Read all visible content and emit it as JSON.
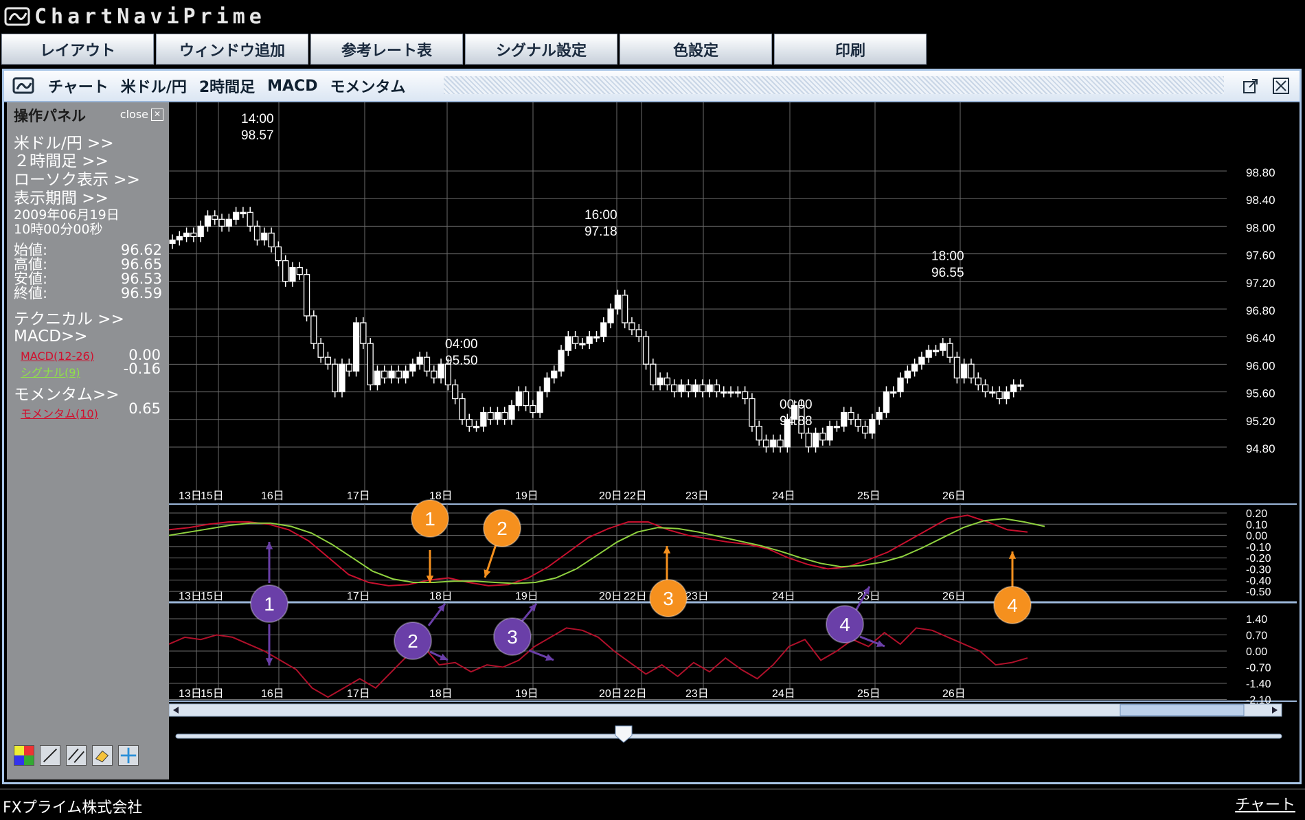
{
  "app": {
    "logo_text": "ChartNaviPrime"
  },
  "menu": [
    "レイアウト",
    "ウィンドウ追加",
    "参考レート表",
    "シグナル設定",
    "色設定",
    "印刷"
  ],
  "window": {
    "title_items": [
      "チャート",
      "米ドル/円",
      "2時間足",
      "MACD",
      "モメンタム"
    ]
  },
  "panel": {
    "title": "操作パネル",
    "close_label": "close",
    "links": {
      "pair": "米ドル/円 >>",
      "timeframe": "２時間足 >>",
      "display": "ローソク表示 >>",
      "period": "表示期間 >>"
    },
    "date": "2009年06月19日",
    "time": "10時00分00秒",
    "ohlc": [
      {
        "label": "始値:",
        "value": "96.62"
      },
      {
        "label": "高値:",
        "value": "96.65"
      },
      {
        "label": "安値:",
        "value": "96.53"
      },
      {
        "label": "終値:",
        "value": "96.59"
      }
    ],
    "technical": "テクニカル >>",
    "macd_link": "MACD>>",
    "macd_label": "MACD(12-26)",
    "macd_value": "0.00",
    "signal_label": "シグナル(9)",
    "signal_value": "-0.16",
    "momentum_link": "モメンタム>>",
    "momentum_label": "モメンタム(10)",
    "momentum_value": "0.65"
  },
  "colors": {
    "macd": "#c8102e",
    "signal": "#8fd13f",
    "momentum": "#b0102a",
    "orange_marker": "#f5901e",
    "purple_marker": "#6a3fa8",
    "grid": "#6c6c6c",
    "panel_bg": "#8f9194",
    "titlebar": "#dbe6f3"
  },
  "chart_data": [
    {
      "type": "candlestick",
      "y_ticks": [
        "98.80",
        "98.40",
        "98.00",
        "97.60",
        "97.20",
        "96.80",
        "96.40",
        "96.00",
        "95.60",
        "95.20",
        "94.80"
      ],
      "ylim": [
        94.6,
        99.0
      ],
      "x_ticks": [
        "13日",
        "15日",
        "16日",
        "17日",
        "18日",
        "19日",
        "20日",
        "22日",
        "23日",
        "24日",
        "25日",
        "26日"
      ],
      "annotations": [
        {
          "time": "14:00",
          "value": "98.57"
        },
        {
          "time": "04:00",
          "value": "95.50"
        },
        {
          "time": "16:00",
          "value": "97.18"
        },
        {
          "time": "00:00",
          "value": "94.88"
        },
        {
          "time": "18:00",
          "value": "96.55"
        }
      ],
      "close": [
        98.0,
        98.05,
        98.1,
        98.05,
        98.2,
        98.35,
        98.3,
        98.2,
        98.3,
        98.4,
        98.4,
        98.2,
        98.0,
        98.1,
        97.9,
        97.7,
        97.4,
        97.6,
        97.5,
        96.9,
        96.5,
        96.3,
        96.2,
        95.8,
        96.2,
        96.1,
        96.8,
        96.5,
        95.9,
        96.1,
        96.0,
        96.1,
        96.0,
        96.1,
        96.2,
        96.3,
        96.1,
        96.0,
        96.2,
        95.9,
        95.7,
        95.4,
        95.3,
        95.3,
        95.5,
        95.4,
        95.5,
        95.4,
        95.6,
        95.8,
        95.6,
        95.5,
        95.8,
        96.0,
        96.1,
        96.4,
        96.6,
        96.5,
        96.5,
        96.6,
        96.6,
        96.8,
        97.0,
        97.2,
        96.8,
        96.7,
        96.6,
        96.2,
        95.9,
        96.0,
        95.9,
        95.8,
        95.9,
        95.8,
        95.9,
        95.8,
        95.9,
        95.8,
        95.8,
        95.8,
        95.8,
        95.7,
        95.3,
        95.1,
        95.0,
        95.1,
        95.0,
        95.4,
        95.6,
        95.2,
        95.0,
        95.2,
        95.1,
        95.3,
        95.3,
        95.5,
        95.4,
        95.3,
        95.2,
        95.4,
        95.5,
        95.8,
        95.8,
        96.0,
        96.1,
        96.2,
        96.3,
        96.4,
        96.4,
        96.5,
        96.3,
        96.0,
        96.2,
        96.0,
        95.9,
        95.8,
        95.8,
        95.7,
        95.8,
        95.9,
        95.9
      ]
    },
    {
      "type": "line",
      "name": "MACD",
      "y_ticks": [
        "0.20",
        "0.10",
        "0.00",
        "-0.10",
        "-0.20",
        "-0.30",
        "-0.40",
        "-0.50"
      ],
      "ylim": [
        -0.55,
        0.25
      ],
      "series": [
        {
          "name": "MACD(12-26)",
          "values": [
            0.05,
            0.07,
            0.1,
            0.12,
            0.12,
            0.1,
            0.05,
            -0.05,
            -0.2,
            -0.35,
            -0.42,
            -0.45,
            -0.44,
            -0.4,
            -0.38,
            -0.42,
            -0.45,
            -0.44,
            -0.38,
            -0.28,
            -0.15,
            -0.02,
            0.06,
            0.12,
            0.12,
            0.05,
            0.0,
            -0.03,
            -0.06,
            -0.08,
            -0.12,
            -0.2,
            -0.26,
            -0.3,
            -0.28,
            -0.22,
            -0.15,
            -0.05,
            0.05,
            0.15,
            0.18,
            0.12,
            0.05,
            0.03
          ]
        },
        {
          "name": "シグナル(9)",
          "values": [
            0.0,
            0.03,
            0.06,
            0.09,
            0.11,
            0.11,
            0.08,
            0.02,
            -0.08,
            -0.2,
            -0.32,
            -0.39,
            -0.42,
            -0.42,
            -0.41,
            -0.41,
            -0.42,
            -0.43,
            -0.42,
            -0.38,
            -0.3,
            -0.18,
            -0.06,
            0.03,
            0.07,
            0.06,
            0.03,
            -0.01,
            -0.05,
            -0.09,
            -0.14,
            -0.2,
            -0.25,
            -0.28,
            -0.27,
            -0.24,
            -0.19,
            -0.11,
            -0.02,
            0.07,
            0.13,
            0.15,
            0.12,
            0.08
          ]
        }
      ]
    },
    {
      "type": "line",
      "name": "Momentum",
      "y_ticks": [
        "1.40",
        "0.70",
        "0.00",
        "-0.70",
        "-1.40",
        "-2.10"
      ],
      "ylim": [
        -2.1,
        1.4
      ],
      "series": [
        {
          "name": "モメンタム(10)",
          "values": [
            0.3,
            0.6,
            0.5,
            0.7,
            0.6,
            0.3,
            0.0,
            -0.4,
            -0.8,
            -1.6,
            -2.0,
            -1.6,
            -1.2,
            -1.6,
            -0.9,
            -0.2,
            0.2,
            -0.6,
            -0.5,
            -0.9,
            -0.6,
            -0.7,
            -0.4,
            0.2,
            0.6,
            1.0,
            0.9,
            0.6,
            0.0,
            -0.5,
            -1.0,
            -0.6,
            -1.1,
            -0.5,
            -0.9,
            -0.3,
            -0.8,
            -1.2,
            -0.6,
            0.2,
            0.5,
            -0.4,
            0.0,
            0.5,
            0.2,
            0.8,
            0.3,
            1.0,
            0.9,
            0.6,
            0.3,
            0.0,
            -0.6,
            -0.5,
            -0.3
          ]
        }
      ]
    }
  ],
  "markers": {
    "orange": [
      "1",
      "2",
      "3",
      "4"
    ],
    "purple": [
      "1",
      "2",
      "3",
      "4"
    ]
  },
  "status": {
    "company": "FXプライム株式会社",
    "right": "チャート"
  }
}
